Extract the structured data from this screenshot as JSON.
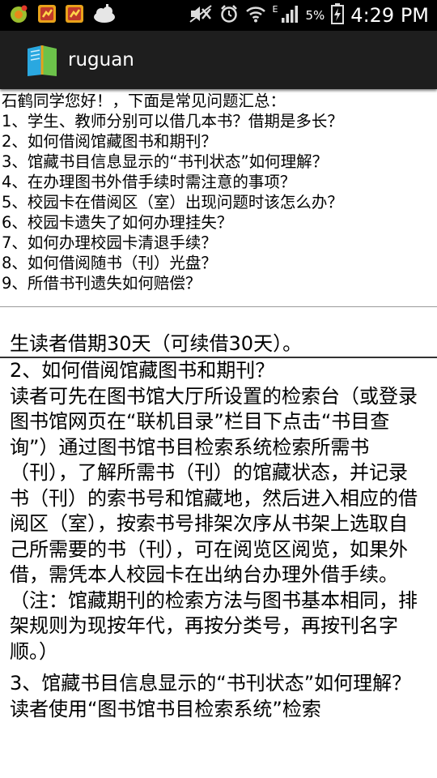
{
  "status_bar": {
    "battery_percent": "5%",
    "time": "4:29 PM",
    "network_type": "E",
    "icons": [
      "app-notification-icon",
      "stocks-icon",
      "stocks-icon",
      "cloud-weather-icon",
      "mute-icon",
      "alarm-icon",
      "wifi-icon",
      "signal-icon",
      "battery-icon"
    ]
  },
  "action_bar": {
    "title": "ruguan",
    "icon": "book-app-icon"
  },
  "summary": {
    "greeting": "石鹤同学您好！，下面是常见问题汇总：",
    "questions": [
      "1、学生、教师分别可以借几本书？借期是多长？",
      "2、如何借阅馆藏图书和期刊？",
      "3、馆藏书目信息显示的“书刊状态”如何理解？",
      "4、在办理图书外借手续时需注意的事项？",
      "5、校园卡在借阅区（室）出现问题时该怎么办？",
      "6、校园卡遗失了如何办理挂失？",
      "7、如何办理校园卡清退手续？",
      "8、如何借阅随书（刊）光盘？",
      "9、所借书刊遗失如何赔偿？"
    ]
  },
  "answer": {
    "partial_top_line": "生读者借期30天（可续借30天）。",
    "sections": [
      {
        "question": "2、如何借阅馆藏图书和期刊？",
        "body": " 读者可先在图书馆大厅所设置的检索台（或登录图书馆网页在“联机目录”栏目下点击“书目查询”）通过图书馆书目检索系统检索所需书（刊），了解所需书（刊）的馆藏状态，并记录书（刊）的索书号和馆藏地，然后进入相应的借阅区（室），按索书号排架次序从书架上选取自己所需要的书（刊），可在阅览区阅览，如果外借，需凭本人校园卡在出纳台办理外借手续。（注：馆藏期刊的检索方法与图书基本相同，排架规则为现按年代，再按分类号，再按刊名字顺。）"
      },
      {
        "question": "3、馆藏书目信息显示的“书刊状态”如何理解？",
        "body": " 读者使用“图书馆书目检索系统”检索"
      }
    ]
  }
}
